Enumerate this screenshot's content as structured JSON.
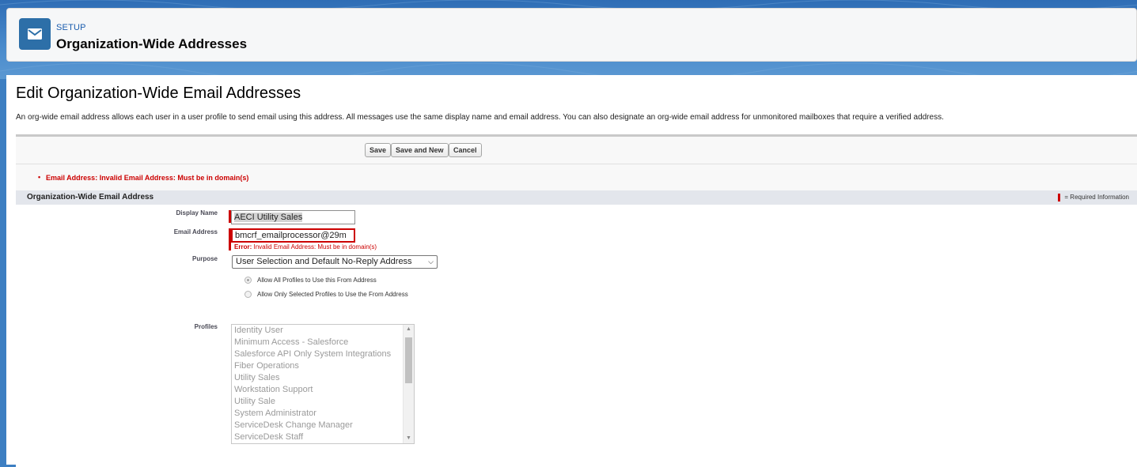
{
  "header": {
    "eyebrow": "SETUP",
    "title": "Organization-Wide Addresses",
    "icon": "envelope-icon"
  },
  "page": {
    "heading": "Edit Organization-Wide Email Addresses",
    "description": "An org-wide email address allows each user in a user profile to send email using this address. All messages use the same display name and email address. You can also designate an org-wide email address for unmonitored mailboxes that require a verified address."
  },
  "buttons": {
    "save": "Save",
    "save_and_new": "Save and New",
    "cancel": "Cancel"
  },
  "page_error": "Email Address: Invalid Email Address: Must be in domain(s)",
  "section": {
    "title": "Organization-Wide Email Address",
    "required_legend": "= Required Information"
  },
  "form": {
    "display_name_label": "Display Name",
    "display_name_value": "AECI Utility Sales",
    "email_label": "Email Address",
    "email_value": "bmcrf_emailprocessor@29m",
    "email_error_prefix": "Error:",
    "email_error_text": "Invalid Email Address: Must be in domain(s)",
    "purpose_label": "Purpose",
    "purpose_value": "User Selection and Default No-Reply Address",
    "radio_all": "Allow All Profiles to Use this From Address",
    "radio_selected": "Allow Only Selected Profiles to Use the From Address",
    "profiles_label": "Profiles",
    "profiles": [
      "Identity User",
      "Minimum Access - Salesforce",
      "Salesforce API Only System Integrations",
      "Fiber Operations",
      "Utility Sales",
      "Workstation Support",
      "Utility Sale",
      "System Administrator",
      "ServiceDesk Change Manager",
      "ServiceDesk Staff"
    ]
  },
  "colors": {
    "error": "#cc0000",
    "brand": "#2d6fa8",
    "link": "#1b5dae"
  }
}
